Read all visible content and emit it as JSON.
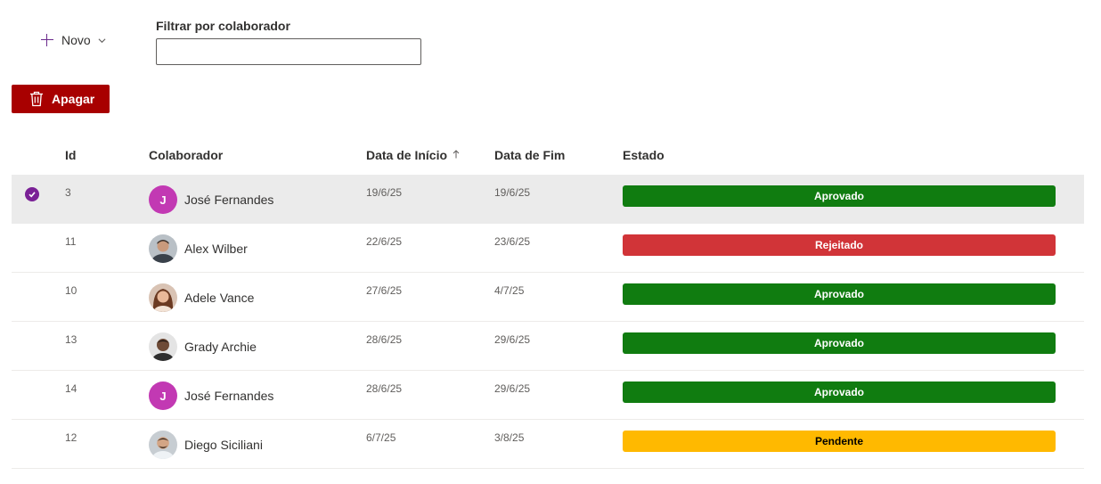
{
  "toolbar": {
    "new_label": "Novo",
    "delete_label": "Apagar"
  },
  "filter": {
    "label": "Filtrar por colaborador",
    "value": "",
    "placeholder": ""
  },
  "table": {
    "headers": {
      "id": "Id",
      "colaborador": "Colaborador",
      "inicio": "Data de Início",
      "fim": "Data de Fim",
      "estado": "Estado"
    },
    "sort_arrow": "↑",
    "rows": [
      {
        "id": "3",
        "initial": "J",
        "name": "José Fernandes",
        "start": "19/6/25",
        "end": "19/6/25",
        "status": "Aprovado"
      },
      {
        "id": "11",
        "initial": "",
        "name": "Alex Wilber",
        "start": "22/6/25",
        "end": "23/6/25",
        "status": "Rejeitado"
      },
      {
        "id": "10",
        "initial": "",
        "name": "Adele Vance",
        "start": "27/6/25",
        "end": "4/7/25",
        "status": "Aprovado"
      },
      {
        "id": "13",
        "initial": "",
        "name": "Grady Archie",
        "start": "28/6/25",
        "end": "29/6/25",
        "status": "Aprovado"
      },
      {
        "id": "14",
        "initial": "J",
        "name": "José Fernandes",
        "start": "28/6/25",
        "end": "29/6/25",
        "status": "Aprovado"
      },
      {
        "id": "12",
        "initial": "",
        "name": "Diego Siciliani",
        "start": "6/7/25",
        "end": "3/8/25",
        "status": "Pendente"
      }
    ]
  },
  "colors": {
    "approved": "#107c10",
    "rejected": "#d13438",
    "pending": "#ffb900",
    "delete": "#a80000",
    "accent": "#7a2196"
  }
}
